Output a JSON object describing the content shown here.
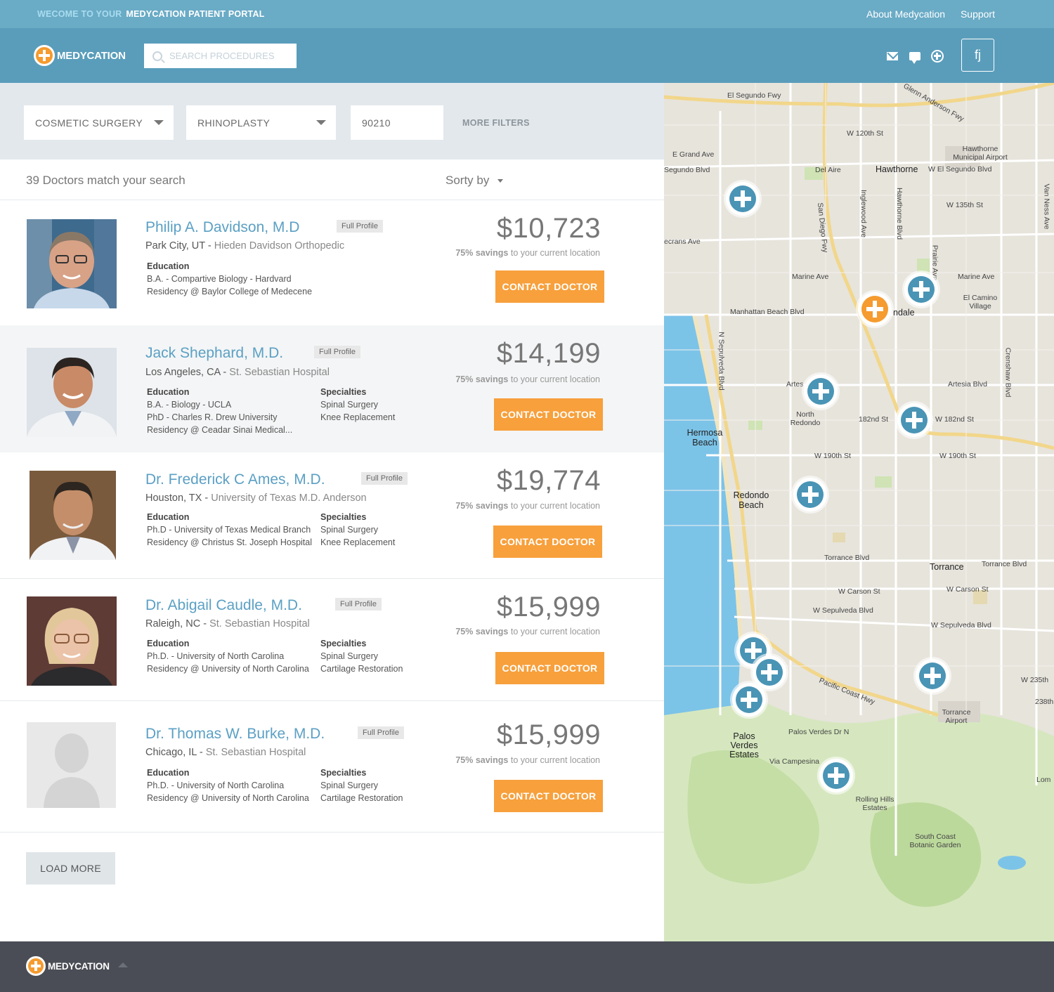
{
  "topbar": {
    "welcome_prefix": "WECOME TO YOUR",
    "welcome_portal": "MEDYCATION PATIENT PORTAL",
    "links": [
      "About Medycation",
      "Support"
    ]
  },
  "header": {
    "brand": "MEDYCATION",
    "search_placeholder": "SEARCH PROCEDURES",
    "icons": [
      "mail-icon",
      "chat-icon",
      "add-circle-icon"
    ],
    "user_initials": "fj"
  },
  "filters": {
    "category": "COSMETIC SURGERY",
    "procedure": "RHINOPLASTY",
    "zip": "90210",
    "more": "MORE FILTERS"
  },
  "results": {
    "count_text": "39 Doctors match your search",
    "sort_label": "Sorty by"
  },
  "doctors": [
    {
      "name": "Philip A. Davidson, M.D",
      "badge": "Full Profile",
      "city": "Park City, UT -",
      "hospital": "Hieden Davidson Orthopedic",
      "education_label": "Education",
      "education": [
        "B.A. - Compartive Biology - Hardvard",
        "Residency @ Baylor College of Medecene"
      ],
      "specialties_label": "",
      "specialties": [],
      "price": "$10,723",
      "savings_pct": "75% savings",
      "savings_rest": " to your current location",
      "cta": "CONTACT DOCTOR"
    },
    {
      "name": "Jack Shephard, M.D.",
      "badge": "Full Profile",
      "city": "Los Angeles, CA -",
      "hospital": "St. Sebastian Hospital",
      "education_label": "Education",
      "education": [
        "B.A. - Biology - UCLA",
        "PhD  - Charles R. Drew University",
        "Residency @ Ceadar Sinai Medical..."
      ],
      "specialties_label": "Specialties",
      "specialties": [
        "Spinal Surgery",
        "Knee Replacement"
      ],
      "price": "$14,199",
      "savings_pct": "75% savings",
      "savings_rest": " to your current location",
      "cta": "CONTACT DOCTOR"
    },
    {
      "name": "Dr. Frederick C Ames, M.D.",
      "badge": "Full Profile",
      "city": "Houston, TX -",
      "hospital": "University of Texas M.D. Anderson",
      "education_label": "Education",
      "education": [
        "Ph.D - University of Texas Medical Branch",
        "Residency @ Christus St. Joseph Hospital"
      ],
      "specialties_label": "Specialties",
      "specialties": [
        "Spinal Surgery",
        "Knee Replacement"
      ],
      "price": "$19,774",
      "savings_pct": "75% savings",
      "savings_rest": " to your current location",
      "cta": "CONTACT DOCTOR"
    },
    {
      "name": "Dr. Abigail Caudle, M.D.",
      "badge": "Full Profile",
      "city": "Raleigh, NC -",
      "hospital": "St. Sebastian Hospital",
      "education_label": "Education",
      "education": [
        "Ph.D. - University of North Carolina",
        "Residency @ University of North Carolina"
      ],
      "specialties_label": "Specialties",
      "specialties": [
        "Spinal Surgery",
        "Cartilage Restoration"
      ],
      "price": "$15,999",
      "savings_pct": "75% savings",
      "savings_rest": " to your current location",
      "cta": "CONTACT DOCTOR"
    },
    {
      "name": "Dr. Thomas W. Burke, M.D.",
      "badge": "Full Profile",
      "city": "Chicago, IL  -",
      "hospital": "St. Sebastian Hospital",
      "education_label": "Education",
      "education": [
        "Ph.D. - University of North Carolina",
        "Residency @ University of North Carolina"
      ],
      "specialties_label": "Specialties",
      "specialties": [
        "Spinal Surgery",
        "Cartilage Restoration"
      ],
      "price": "$15,999",
      "savings_pct": "75% savings",
      "savings_rest": " to your current location",
      "cta": "CONTACT DOCTOR"
    }
  ],
  "load_more": "LOAD MORE",
  "map": {
    "labels": [
      "El Segundo Fwy",
      "Glenn Anderson Fwy",
      "W 120th St",
      "E Grand Ave",
      "Segundo Blvd",
      "Del Aire",
      "Hawthorne",
      "W El Segundo Blvd",
      "Hawthorne Municipal Airport",
      "W 135th St",
      "ecrans Ave",
      "Marine Ave",
      "Marine Ave",
      "El Camino Village",
      "Manhattan Beach Blvd",
      "ndale",
      "Artes",
      "Artesia Blvd",
      "North Redondo",
      "182nd St",
      "W 182nd St",
      "Hermosa Beach",
      "W 190th St",
      "W 190th St",
      "Redondo Beach",
      "Torrance Blvd",
      "Torrance",
      "Torrance Blvd",
      "W Carson St",
      "W Carson St",
      "W Sepulveda Blvd",
      "W Sepulveda Blvd",
      "Palos Verdes Estates",
      "Palos Verdes Dr N",
      "Via Campesina",
      "Torrance Airport",
      "Rolling Hills Estates",
      "South Coast Botanic Garden",
      "W 235th",
      "Lom",
      "Pacific Coast Hwy",
      "Hawthorne Blvd",
      "Crenshaw Blvd",
      "N Sepulveda Blvd",
      "Inglewood Ave",
      "San Diego Fwy",
      "Prairie Ave",
      "Van Ness Ave",
      "238th"
    ],
    "colors": {
      "water": "#7cc3e8",
      "land": "#e7e4dc",
      "park": "#cfe3b4",
      "road": "#ffffff",
      "freeway": "#f2d68a",
      "pin_blue": "#4a94b5",
      "pin_orange": "#f59b2f"
    }
  },
  "footer": {
    "brand": "MEDYCATION"
  }
}
